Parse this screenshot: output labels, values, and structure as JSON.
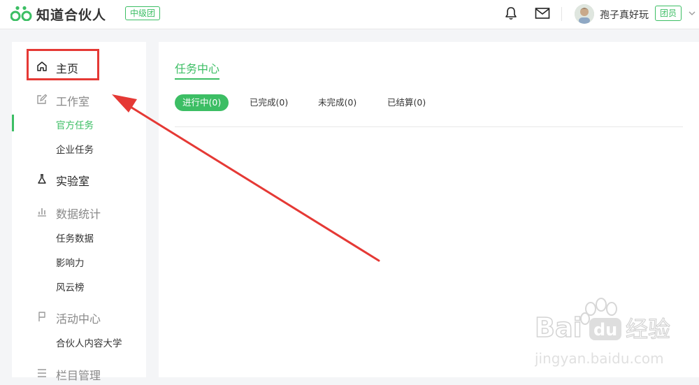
{
  "header": {
    "logo_text": "知道合伙人",
    "level_badge": "中级团",
    "username": "孢子真好玩",
    "role_badge": "团员"
  },
  "sidebar": {
    "home": "主页",
    "studio": "工作室",
    "official_tasks": "官方任务",
    "enterprise_tasks": "企业任务",
    "lab": "实验室",
    "stats": "数据统计",
    "task_data": "任务数据",
    "influence": "影响力",
    "ranking": "风云榜",
    "events": "活动中心",
    "partner_university": "合伙人内容大学",
    "next_section_partial": "栏目管理"
  },
  "main": {
    "title": "任务中心",
    "tabs": [
      {
        "label": "进行中(0)",
        "active": true
      },
      {
        "label": "已完成(0)",
        "active": false
      },
      {
        "label": "未完成(0)",
        "active": false
      },
      {
        "label": "已结算(0)",
        "active": false
      }
    ]
  },
  "watermark": {
    "brand": "Baidu经验",
    "url": "jingyan.baidu.com"
  },
  "colors": {
    "accent": "#3cbe64",
    "annotation": "#e53935"
  }
}
